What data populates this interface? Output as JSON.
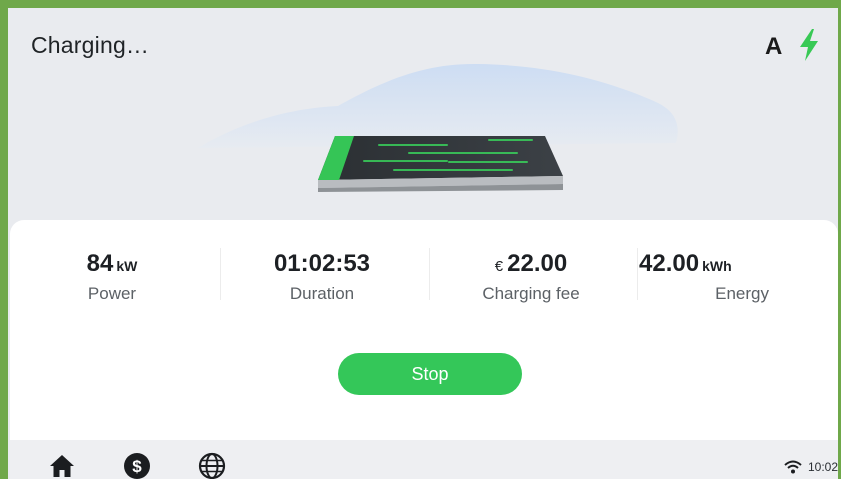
{
  "header": {
    "title": "Charging…",
    "mode_letter": "A",
    "status_icon": "lightning-bolt-icon"
  },
  "stats": [
    {
      "value": "84",
      "unit": "kW",
      "prefix": "",
      "label": "Power"
    },
    {
      "value": "01:02:53",
      "unit": "",
      "prefix": "",
      "label": "Duration"
    },
    {
      "value": "22.00",
      "unit": "",
      "prefix": "€",
      "label": "Charging fee"
    },
    {
      "value": "42.00",
      "unit": "kWh",
      "prefix": "",
      "label": "Energy"
    }
  ],
  "actions": {
    "stop_label": "Stop"
  },
  "bottom_nav": {
    "items": [
      "home-icon",
      "dollar-icon",
      "globe-icon"
    ],
    "time": "10:02",
    "signal_icon": "wifi-icon"
  },
  "colors": {
    "accent": "#34c759",
    "frame": "#6fa84a",
    "bolt": "#38c955"
  }
}
